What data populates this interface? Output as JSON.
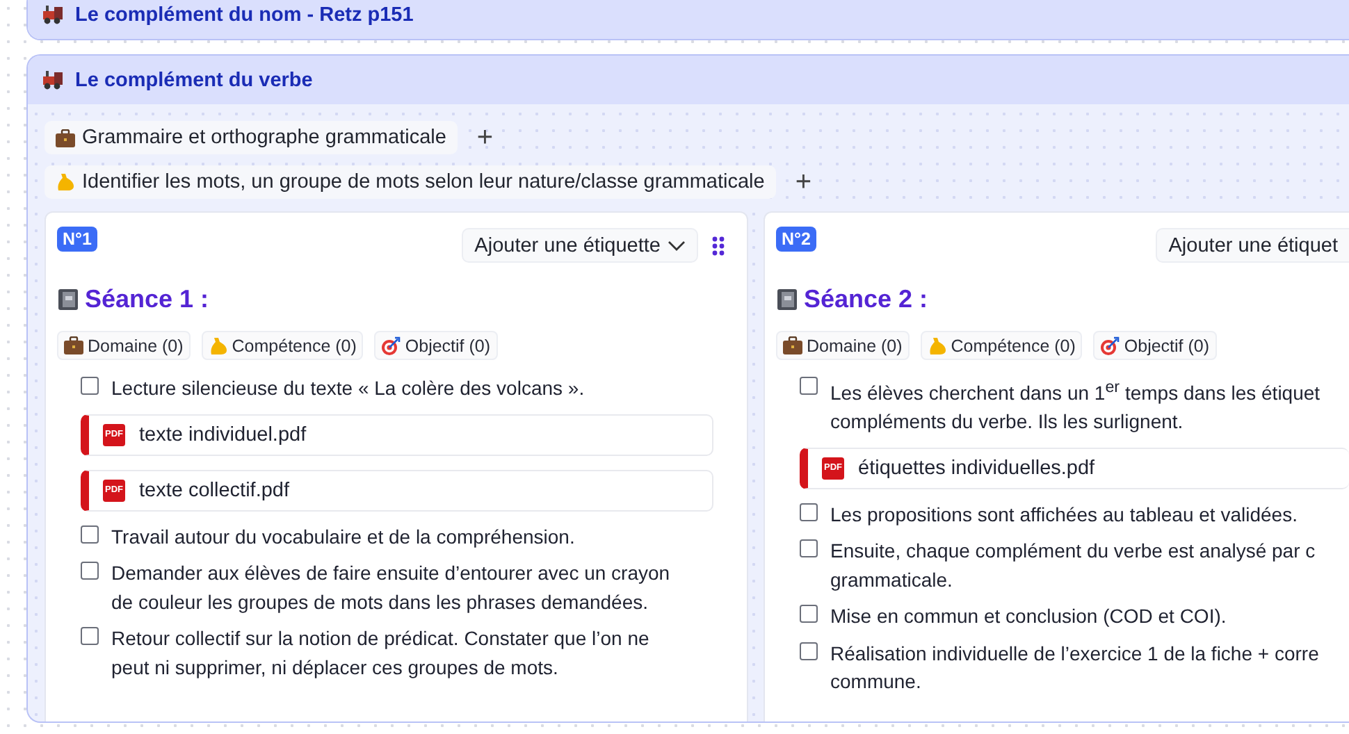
{
  "sections": [
    {
      "title": "Le complément du nom - Retz p151",
      "expanded": false
    },
    {
      "title": "Le complément du verbe",
      "expanded": true,
      "tags": [
        {
          "kind": "domain",
          "label": "Grammaire et orthographe grammaticale",
          "add": "+"
        },
        {
          "kind": "skill",
          "label": "Identifier les mots, un groupe de mots selon leur nature/classe grammaticale",
          "add": "+"
        }
      ],
      "sessions": [
        {
          "number": "N°1",
          "tag_button": "Ajouter une étiquette",
          "dropdown": true,
          "handle": true,
          "title": "Séance 1 :",
          "chips": [
            {
              "kind": "domain",
              "label": "Domaine (0)"
            },
            {
              "kind": "skill",
              "label": "Compétence (0)"
            },
            {
              "kind": "objective",
              "label": "Objectif (0)"
            }
          ],
          "items": [
            {
              "kind": "task",
              "checked": false,
              "lines": [
                "Lecture silencieuse du texte « La colère des volcans »."
              ]
            },
            {
              "kind": "file",
              "badge": "PDF",
              "name": "texte individuel.pdf"
            },
            {
              "kind": "file",
              "badge": "PDF",
              "name": "texte collectif.pdf"
            },
            {
              "kind": "task",
              "checked": false,
              "lines": [
                "Travail autour du vocabulaire et de la compréhension."
              ]
            },
            {
              "kind": "task",
              "checked": false,
              "lines": [
                "Demander aux élèves de faire ensuite d’entourer avec un crayon",
                "de couleur les groupes de mots dans les phrases demandées."
              ]
            },
            {
              "kind": "task",
              "checked": false,
              "lines": [
                "Retour collectif sur la notion de prédicat. Constater que l’on ne",
                "peut ni supprimer, ni déplacer ces groupes de mots."
              ]
            }
          ]
        },
        {
          "number": "N°2",
          "tag_button": "Ajouter une étiquet",
          "dropdown": false,
          "handle": false,
          "title": "Séance 2 :",
          "chips": [
            {
              "kind": "domain",
              "label": "Domaine (0)"
            },
            {
              "kind": "skill",
              "label": "Compétence (0)"
            },
            {
              "kind": "objective",
              "label": "Objectif (0)"
            }
          ],
          "items": [
            {
              "kind": "task",
              "checked": false,
              "lines": [
                "Les élèves cherchent dans un 1$^{er}$ temps dans les étiquet",
                "compléments du verbe. Ils les surlignent."
              ]
            },
            {
              "kind": "file",
              "badge": "PDF",
              "name": "étiquettes individuelles.pdf"
            },
            {
              "kind": "task",
              "checked": false,
              "lines": [
                "Les propositions sont affichées au tableau et validées."
              ]
            },
            {
              "kind": "task",
              "checked": false,
              "lines": [
                "Ensuite, chaque complément du verbe est analysé par c",
                "grammaticale."
              ]
            },
            {
              "kind": "task",
              "checked": false,
              "lines": [
                "Mise en commun et conclusion (COD et COI)."
              ]
            },
            {
              "kind": "task",
              "checked": false,
              "lines": [
                "Réalisation individuelle de l’exercice 1 de la fiche + corre",
                "commune."
              ]
            }
          ]
        }
      ]
    }
  ]
}
